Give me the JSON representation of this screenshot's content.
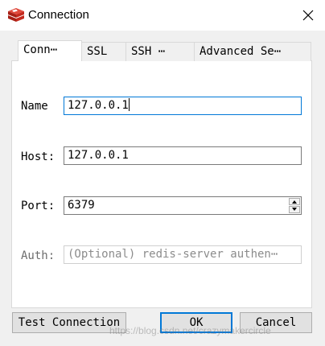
{
  "window": {
    "title": "Connection",
    "icon": "redis-logo-icon",
    "close_icon": "close-icon"
  },
  "tabs": [
    {
      "label": "Conn⋯",
      "active": true
    },
    {
      "label": "SSL",
      "active": false
    },
    {
      "label": "SSH ⋯",
      "active": false
    },
    {
      "label": "Advanced Se⋯",
      "active": false
    }
  ],
  "form": {
    "name": {
      "label": "Name",
      "value": "127.0.0.1"
    },
    "host": {
      "label": "Host:",
      "value": "127.0.0.1"
    },
    "port": {
      "label": "Port:",
      "value": "6379"
    },
    "auth": {
      "label": "Auth:",
      "placeholder": "(Optional) redis-server authen⋯"
    }
  },
  "buttons": {
    "test": "Test Connection",
    "ok": "OK",
    "cancel": "Cancel"
  },
  "watermark": "https://blog.csdn.net/crazymakercircle",
  "colors": {
    "focus": "#0078d7",
    "logo": "#d82c20"
  }
}
